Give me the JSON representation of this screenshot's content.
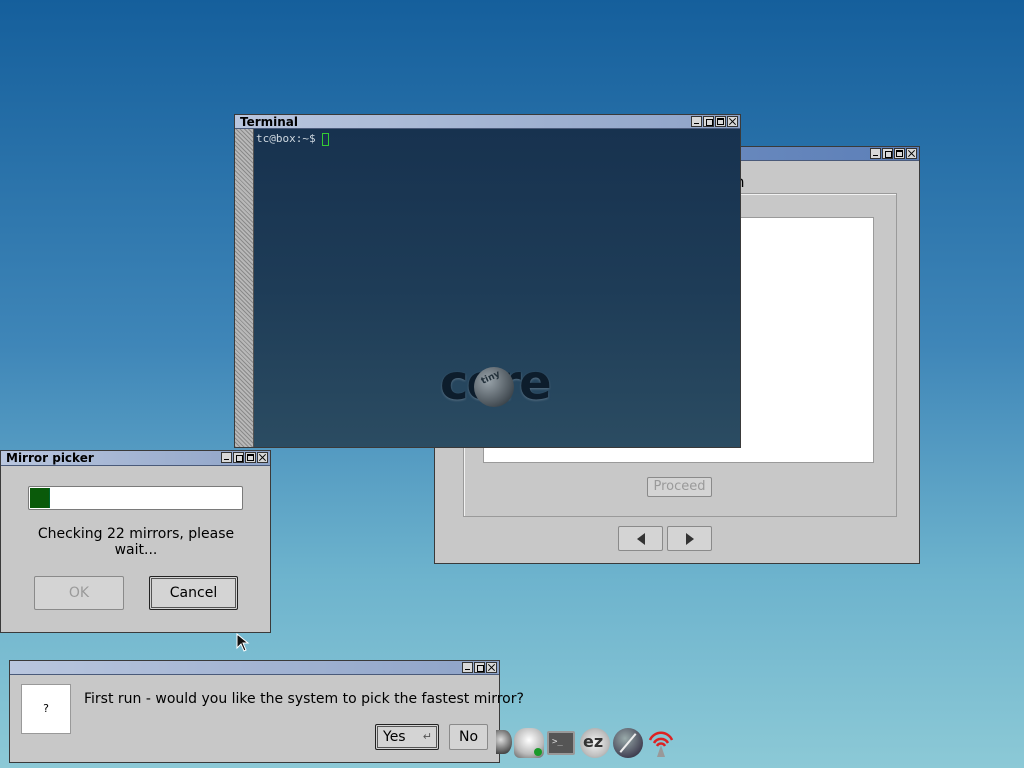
{
  "terminal": {
    "title": "Terminal",
    "prompt": "tc@box:~$",
    "logo_text": "core",
    "logo_badge": "tiny"
  },
  "installer": {
    "heading_fragment": "n",
    "proceed_label": "Proceed",
    "prev_icon": "left-arrow-icon",
    "next_icon": "right-arrow-icon"
  },
  "mirror_picker": {
    "title": "Mirror picker",
    "progress": 0.09,
    "message": "Checking 22 mirrors, please wait...",
    "ok_label": "OK",
    "cancel_label": "Cancel"
  },
  "first_run": {
    "title": "",
    "icon_text": "?",
    "question": "First run - would you like the system to pick the fastest mirror?",
    "yes_label": "Yes",
    "no_label": "No"
  },
  "dock": {
    "items": [
      "control-panel-icon",
      "apps-icon",
      "terminal-icon",
      "ezremaster-icon",
      "mount-tool-icon",
      "wifi-icon"
    ],
    "ezremaster_label": "ez"
  },
  "colors": {
    "terminal_bg": "#1e3a55",
    "progress_fill": "#0a5a0a",
    "titlebar_active": "#8ea3c8"
  }
}
